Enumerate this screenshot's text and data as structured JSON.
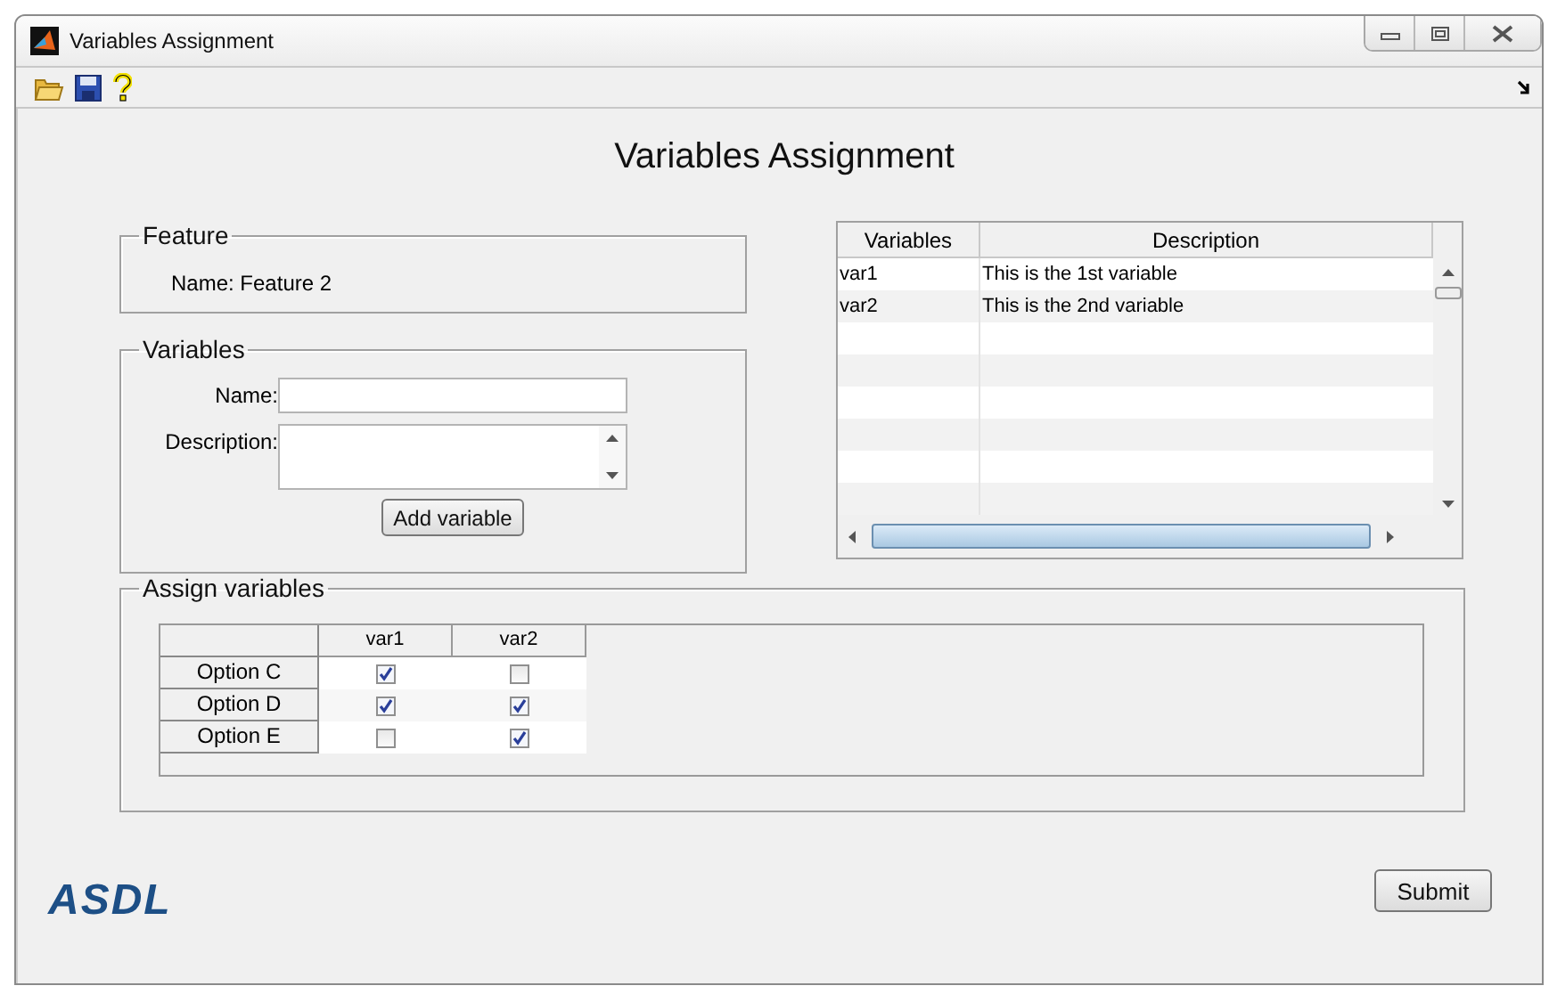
{
  "window": {
    "title": "Variables Assignment"
  },
  "heading": "Variables Assignment",
  "feature_panel": {
    "title": "Feature",
    "name_text": "Name: Feature 2"
  },
  "variables_panel": {
    "title": "Variables",
    "name_label": "Name:",
    "description_label": "Description:",
    "add_button": "Add variable"
  },
  "variables_table": {
    "columns": [
      "Variables",
      "Description"
    ],
    "rows": [
      [
        "var1",
        "This is the 1st variable"
      ],
      [
        "var2",
        "This is the 2nd variable"
      ]
    ]
  },
  "assign_panel": {
    "title": "Assign variables",
    "columns": [
      "var1",
      "var2"
    ],
    "rows": [
      {
        "label": "Option C",
        "checks": [
          true,
          false
        ]
      },
      {
        "label": "Option D",
        "checks": [
          true,
          true
        ]
      },
      {
        "label": "Option E",
        "checks": [
          false,
          true
        ]
      }
    ]
  },
  "submit_button": "Submit",
  "logo": "ASDL"
}
